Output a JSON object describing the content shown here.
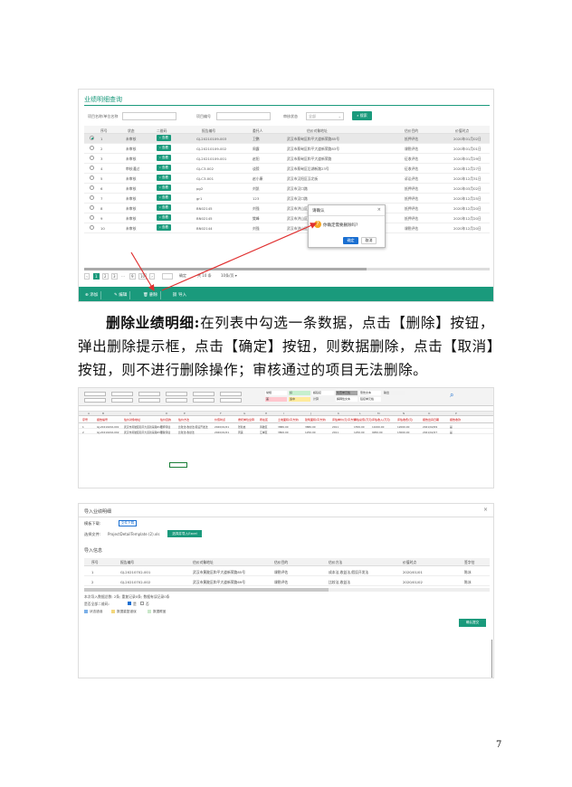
{
  "shot1": {
    "title": "业绩明细查询",
    "filter": {
      "name_label": "项目名称/单位名称",
      "code_label": "项目编号",
      "status_label": "审核状态",
      "status_value": "全部",
      "search_label": "搜索"
    },
    "columns": [
      "序号",
      "状态",
      "二维码",
      "报告编号",
      "委托人",
      "估价对象地址",
      "估价目的",
      "价值时点"
    ],
    "rows": [
      {
        "no": "1",
        "status": "未审核",
        "qr": "查看",
        "code": "GJ-20210109-003",
        "client": "卫鹏",
        "addr": "武汉市蔡甸区和平大道新荣路85号",
        "purpose": "抵押评估",
        "date": "2020年01月02日"
      },
      {
        "no": "2",
        "status": "未审核",
        "qr": "查看",
        "code": "GJ-20210109-002",
        "client": "周露",
        "addr": "武汉市蔡甸区和平大道新荣路83号",
        "purpose": "课税评估",
        "date": "2020年01月01日"
      },
      {
        "no": "3",
        "status": "未审核",
        "qr": "查看",
        "code": "GJ-20210109-001",
        "client": "赵阳",
        "addr": "武汉市蔡甸区和平大道新荣路",
        "purpose": "征收评估",
        "date": "2020年01月29日"
      },
      {
        "no": "4",
        "status": "审核通过",
        "qr": "查看",
        "code": "GJ-C3-002",
        "client": "谈毅",
        "addr": "武汉市蔡甸区后湖新路23号",
        "purpose": "征收评估",
        "date": "2020年12月27日"
      },
      {
        "no": "5",
        "status": "未审核",
        "qr": "查看",
        "code": "GJ-C3-001",
        "client": "赵小康",
        "addr": "武汉市汉阳区汉北街",
        "purpose": "诉讼评估",
        "date": "2020年12月31日"
      },
      {
        "no": "6",
        "status": "未审核",
        "qr": "查看",
        "code": "pg2",
        "client": "刘凯",
        "addr": "武汉市汉口路",
        "purpose": "抵押评估",
        "date": "2020年03月02日"
      },
      {
        "no": "7",
        "status": "未审核",
        "qr": "查看",
        "code": "gr1",
        "client": "123",
        "addr": "武汉市汉口路",
        "purpose": "抵押评估",
        "date": "2020年12月25日"
      },
      {
        "no": "8",
        "status": "未审核",
        "qr": "查看",
        "code": "BN02145",
        "client": "刘强",
        "addr": "武汉市洪山区",
        "purpose": "抵押评估",
        "date": "2020年12月20日"
      },
      {
        "no": "9",
        "status": "未审核",
        "qr": "查看",
        "code": "BN02145",
        "client": "樊峰",
        "addr": "武汉市洪山区",
        "purpose": "抵押评估",
        "date": "2020年12月20日"
      },
      {
        "no": "10",
        "status": "未审核",
        "qr": "查看",
        "code": "BN02144",
        "client": "刘强",
        "addr": "武汉市洪山区珞平安路4号",
        "purpose": "课税评估",
        "date": "2020年12月20日"
      }
    ],
    "pager": [
      "1",
      "2",
      "3",
      "...",
      "9",
      "10"
    ],
    "pager_go": "确定",
    "pager_total": "共 10 条",
    "pager_size": "10条/页",
    "actions": [
      "添加",
      "编辑",
      "删除",
      "导入"
    ],
    "modal": {
      "title": "请确认",
      "message": "你确定需要删除吗?",
      "ok": "确定",
      "cancel": "取消"
    }
  },
  "paragraph": {
    "bold": "删除业绩明细:",
    "text": "在列表中勾选一条数据，点击【删除】按钮，弹出删除提示框，点击【确定】按钮，则数据删除，点击【取消】按钮，则不进行删除操作；审核通过的项目无法删除。"
  },
  "shot2": {
    "ribbon_styles": [
      "常规",
      "差",
      "好",
      "适中",
      "超链接",
      "计算",
      "检查单元格",
      "解释性文本",
      "警告文本",
      "链接单元格",
      "输出"
    ],
    "col_letters": [
      "A",
      "B",
      "C",
      "D",
      "E",
      "F",
      "G",
      "H",
      "I",
      "J",
      "K",
      "L",
      "M",
      "N",
      "O",
      "P"
    ],
    "headers": [
      "序号",
      "报告编号",
      "估价对象地址",
      "估价目的",
      "估价方法",
      "价值时点",
      "委托单位全称",
      "所在区",
      "土地面积(平方米)",
      "建筑面积(平方米)",
      "评估单价(元/平方米)",
      "评估总值(万元)",
      "评估收入(万元)",
      "评估收费(元)",
      "报告出具日期",
      "报告收款"
    ],
    "rows": [
      [
        "1",
        "GJ-20210202-001",
        "武汉市黄陂区和平大道新荣路81号",
        "抵押评估",
        "比较法,收益法,假设开发法",
        "2020/01/01",
        "张新启",
        "黄陂区",
        "3880.00",
        "3880.00",
        "2011",
        "1550.00",
        "11000.00",
        "12000.00",
        "2021/02/09",
        "是"
      ],
      [
        "2",
        "GJ-20210202-002",
        "武汉市黄陂区和平大道新荣路83号",
        "课税评估",
        "比较法,收益法",
        "2020/01/01",
        "周露",
        "江岸区",
        "3800.00",
        "1250.00",
        "2011",
        "1250.00",
        "9950.00",
        "13000.00",
        "2021/02/27",
        "是"
      ]
    ]
  },
  "shot3": {
    "title": "导入业绩明细",
    "template_label": "模板下载:",
    "template_btn": "文件下载",
    "choose_label": "选择文件:",
    "filename": "ProjectDetailTemplate (2).xls",
    "pick_btn": "选择并导入Excel",
    "section": "导入信息",
    "columns": [
      "序号",
      "报告编号",
      "估价对象地址",
      "估价目的",
      "估价方法",
      "价值时点",
      "签字估"
    ],
    "rows": [
      [
        "1",
        "GJ-20210702-001",
        "武汉市黄陂区和平大道新荣路85号",
        "课税评估",
        "成本法,收益法,假设开发法",
        "2020/01/01",
        "陈冰"
      ],
      [
        "2",
        "GJ-20210702-002",
        "武汉市黄陂区和平大道新荣路69号",
        "课税评估",
        "比较法,收益法",
        "2020/01/02",
        "陈冰"
      ]
    ],
    "stats": "本次导入数据总数: 2条; 重复记录0条; 数据有误记录0条",
    "overwrite_label": "是否全部二维码:",
    "opt_yes": "是",
    "opt_no": "否",
    "legend": [
      "状态错误",
      "数据重复错误",
      "数据覆盖"
    ],
    "submit": "确认提交"
  },
  "page_number": "7",
  "colors": {
    "primary": "#1a9a7c",
    "blue": "#1a6fd1",
    "arrow": "#e03030"
  }
}
